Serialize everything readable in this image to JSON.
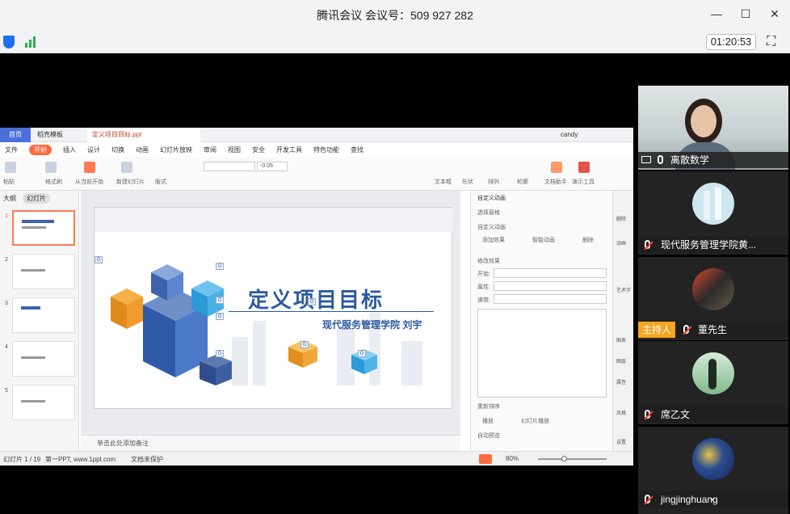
{
  "window": {
    "title": "腾讯会议 会议号：509 927 282",
    "timer": "01:20:53"
  },
  "wps": {
    "tabs": [
      "首页",
      "稻壳模板",
      "定义项目目标.ppt"
    ],
    "account": "candy",
    "menu": [
      "文件",
      "开始",
      "插入",
      "设计",
      "切换",
      "动画",
      "幻灯片放映",
      "审阅",
      "视图",
      "安全",
      "开发工具",
      "特色功能",
      "查找"
    ],
    "active_menu": "开始",
    "font_size_value": "-0.05",
    "ribbon_labels": [
      "粘贴",
      "格式刷",
      "从当前开始",
      "新建幻灯片",
      "版式",
      "文本框",
      "形状",
      "排列",
      "轮廓",
      "文档助手",
      "演示工具"
    ],
    "left_tabs": [
      "大纲",
      "幻灯片"
    ],
    "slide_numbers": [
      "1",
      "2",
      "3",
      "4",
      "5"
    ],
    "slide": {
      "title": "定义项目目标",
      "subtitle": "现代服务管理学院  刘宇",
      "markers": [
        "0",
        "0",
        "0",
        "0",
        "0",
        "0",
        "0",
        "0"
      ]
    },
    "notes_placeholder": "单击此处添加备注",
    "right_panel": {
      "header": "自定义动画",
      "select_pane": "选择窗格",
      "section1": "自定义动画",
      "add_effect": "添加效果",
      "smart_anim": "智能动画",
      "delete": "删除",
      "modify": "修改效果",
      "start_label": "开始:",
      "prop_label": "属性:",
      "speed_label": "速度:",
      "reorder": "重新排序",
      "play": "播放",
      "slideshow": "幻灯片播放",
      "autopreview": "自动预览"
    },
    "right_side": [
      "删除",
      "动画",
      "艺术字",
      "图表",
      "图层",
      "属性",
      "风格",
      "设置"
    ],
    "status": {
      "slide_count": "幻灯片 1 / 19",
      "theme": "第一PPT, www.1ppt.com",
      "doc_protect": "文档未保护",
      "zoom": "80%"
    }
  },
  "participants": [
    {
      "name": "离散数学",
      "host": false
    },
    {
      "name": "现代服务管理学院黄...",
      "host": false
    },
    {
      "name": "董先生",
      "host": true,
      "host_label": "主持人"
    },
    {
      "name": "席乙文",
      "host": false
    },
    {
      "name": "jingjinghuang",
      "host": false
    }
  ]
}
